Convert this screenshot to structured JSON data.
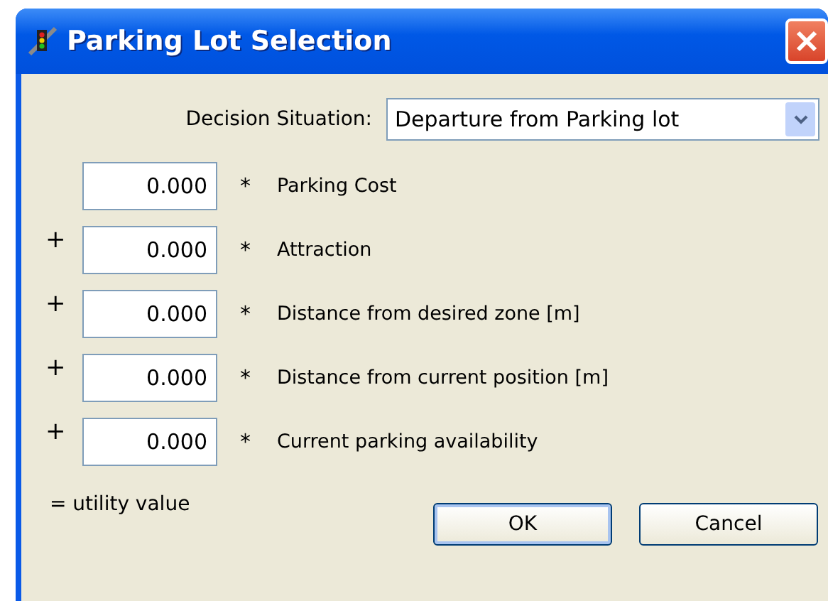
{
  "window": {
    "title": "Parking Lot Selection"
  },
  "decision": {
    "label": "Decision Situation:",
    "value": "Departure from Parking lot"
  },
  "terms": [
    {
      "value": "0.000",
      "multiply": "*",
      "label": "Parking Cost"
    },
    {
      "operator": "+",
      "value": "0.000",
      "multiply": "*",
      "label": "Attraction"
    },
    {
      "operator": "+",
      "value": "0.000",
      "multiply": "*",
      "label": "Distance from desired zone [m]"
    },
    {
      "operator": "+",
      "value": "0.000",
      "multiply": "*",
      "label": "Distance from current position [m]"
    },
    {
      "operator": "+",
      "value": "0.000",
      "multiply": "*",
      "label": "Current parking availability"
    }
  ],
  "result": "= utility value",
  "buttons": [
    {
      "label": "OK",
      "default": true
    },
    {
      "label": "Cancel",
      "default": false
    }
  ]
}
